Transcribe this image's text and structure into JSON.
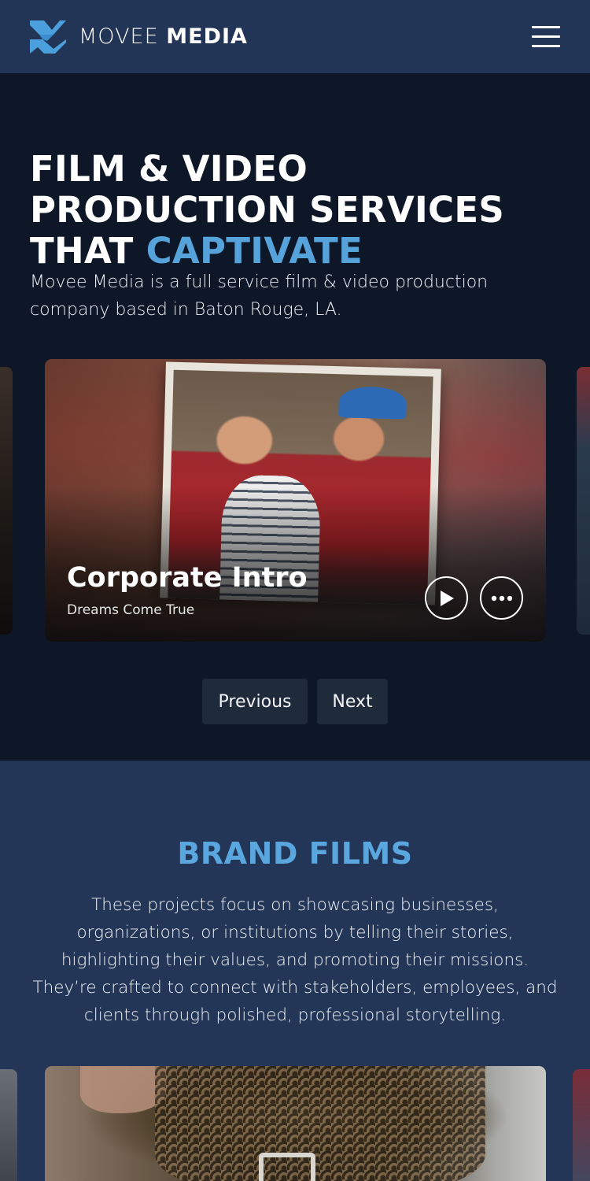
{
  "header": {
    "brand_light": "MOVEE",
    "brand_bold": "MEDIA",
    "logo_icon": "movee-logo-icon",
    "menu_icon": "hamburger-menu-icon"
  },
  "hero": {
    "title_line1": "FILM & VIDEO",
    "title_line2": "PRODUCTION SERVICES",
    "title_line3_plain": "THAT ",
    "title_line3_accent": "CAPTIVATE",
    "lead": "Movee Media is a full service film & video production company based in Baton Rouge, LA."
  },
  "carousel": {
    "active_card": {
      "title": "Corporate Intro",
      "subtitle": "Dreams Come True",
      "play_icon": "play-icon",
      "more_icon": "more-options-icon"
    },
    "previous_label": "Previous",
    "next_label": "Next"
  },
  "brand_films": {
    "title": "BRAND FILMS",
    "description": "These projects focus on showcasing businesses, organizations, or institutions by telling their stories, highlighting their values, and promoting their missions. They’re crafted to connect with stakeholders, employees, and clients through polished, professional storytelling."
  },
  "colors": {
    "header_bg": "#233556",
    "page_bg": "#0e1727",
    "accent": "#56a3dc",
    "section_bg": "#243657",
    "button_bg": "#1f2a3b"
  }
}
